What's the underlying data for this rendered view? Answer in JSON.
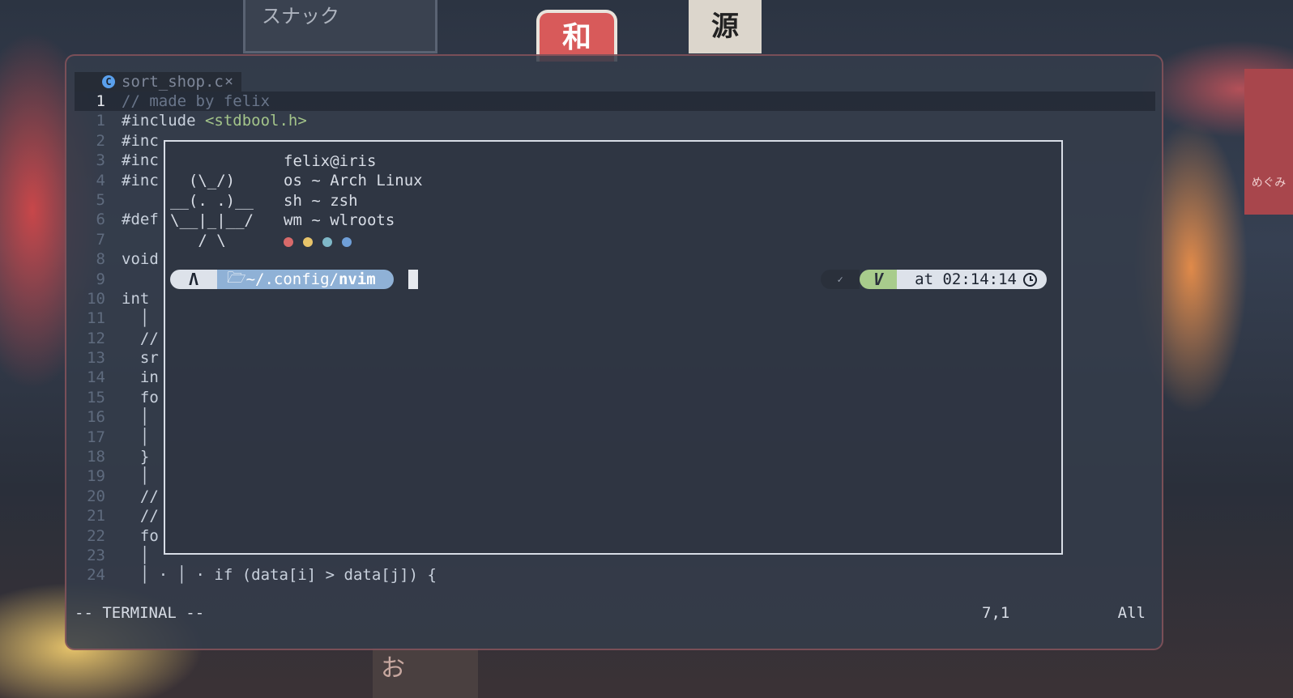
{
  "background": {
    "sign_top": "和",
    "sign_left": "スナック",
    "sign_right": "源",
    "sign_far_right": "めぐみ",
    "sign_bottom": "お"
  },
  "tab": {
    "icon": "c-file-icon",
    "icon_glyph": "C",
    "name": "sort_shop.c",
    "close": "×"
  },
  "editor": {
    "lines": [
      {
        "num": "1",
        "code": "// made by felix",
        "kind": "comment",
        "current": true
      },
      {
        "num": "1",
        "code": "#include ",
        "extra": "<stdbool.h>",
        "kind": "include"
      },
      {
        "num": "2",
        "code": "#inc"
      },
      {
        "num": "3",
        "code": "#inc"
      },
      {
        "num": "4",
        "code": "#inc"
      },
      {
        "num": "5",
        "code": ""
      },
      {
        "num": "6",
        "code": "#def"
      },
      {
        "num": "7",
        "code": ""
      },
      {
        "num": "8",
        "code": "void"
      },
      {
        "num": "9",
        "code": ""
      },
      {
        "num": "10",
        "code": "int "
      },
      {
        "num": "11",
        "code": "  │"
      },
      {
        "num": "12",
        "code": "  //"
      },
      {
        "num": "13",
        "code": "  sr"
      },
      {
        "num": "14",
        "code": "  in"
      },
      {
        "num": "15",
        "code": "  fo"
      },
      {
        "num": "16",
        "code": "  │"
      },
      {
        "num": "17",
        "code": "  │"
      },
      {
        "num": "18",
        "code": "  }"
      },
      {
        "num": "19",
        "code": "  │"
      },
      {
        "num": "20",
        "code": "  //"
      },
      {
        "num": "21",
        "code": "  //"
      },
      {
        "num": "22",
        "code": "  fo"
      },
      {
        "num": "23",
        "code": "  │"
      },
      {
        "num": "24",
        "code": "  │ · │ · if (data[i] > data[j]) {"
      }
    ]
  },
  "terminal": {
    "ascii": "        \n  (\\_/)  \n__(. .)__\n\\__|_|__/\n   / \\   ",
    "info": [
      "felix@iris",
      "os ~ Arch Linux",
      "sh ~ zsh",
      "wm ~ wlroots"
    ],
    "dot_colors": [
      "#d86a6a",
      "#e8c46a",
      "#7fb8c8",
      "#6f9fd8"
    ],
    "prompt": {
      "arch_icon": "Λ",
      "folder_icon": "🗁",
      "dir_prefix": "~/.config/",
      "dir_name": "nvim",
      "status_icon": "✓",
      "vi_mode": "V",
      "time": "at 02:14:14"
    }
  },
  "statusline": {
    "mode": "-- TERMINAL --",
    "position": "7,1",
    "scroll": "All"
  }
}
